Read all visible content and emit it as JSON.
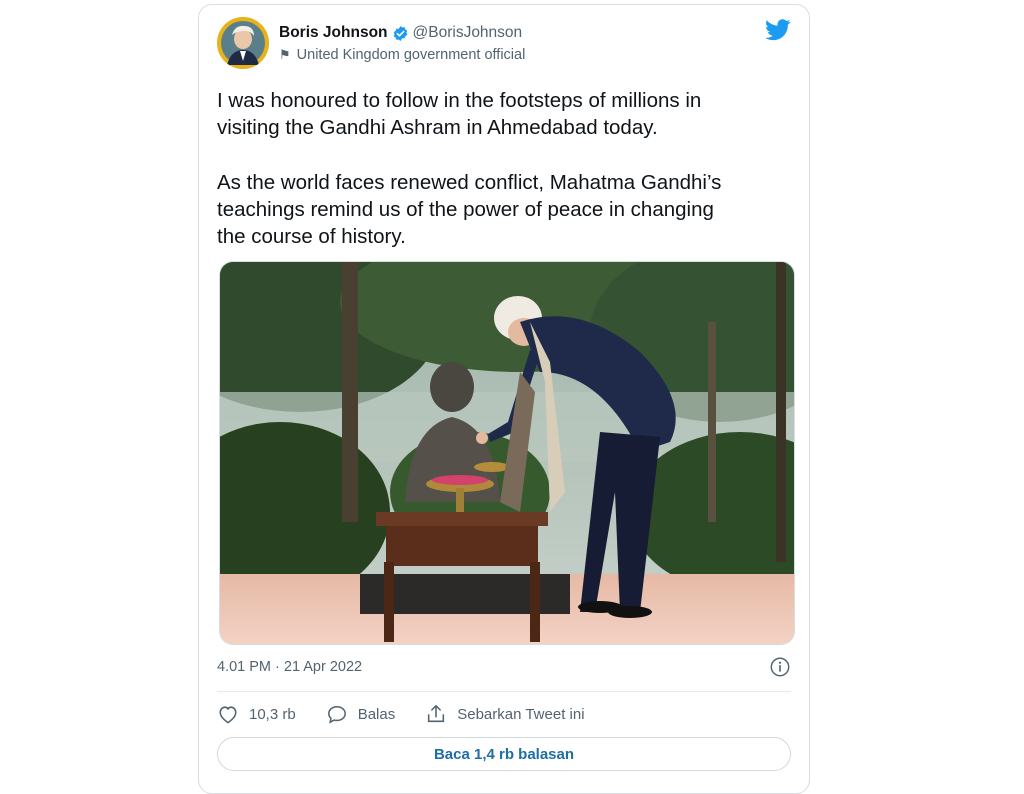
{
  "tweet": {
    "author": {
      "display_name": "Boris Johnson",
      "handle": "@BorisJohnson",
      "affiliation": "United Kingdom government official",
      "avatar_icon": "profile-photo",
      "verified_icon": "verified-badge-icon"
    },
    "text_paragraphs": [
      "I was honoured to follow in the footsteps of millions in\nvisiting the Gandhi Ashram in Ahmedabad today.",
      "As the world faces renewed conflict, Mahatma Gandhi’s\nteachings remind us of the power of peace in changing\nthe course of history."
    ],
    "timestamp": "4.01 PM · 21 Apr 2022",
    "actions": {
      "like_count": "10,3 rb",
      "reply_label": "Balas",
      "share_label": "Sebarkan Tweet ini"
    },
    "read_replies_label": "Baca 1,4 rb balasan"
  },
  "colors": {
    "twitter_blue": "#1d9bf0",
    "link_blue": "#1d6fa5",
    "secondary_text": "#536471",
    "border": "#d8dde2"
  }
}
